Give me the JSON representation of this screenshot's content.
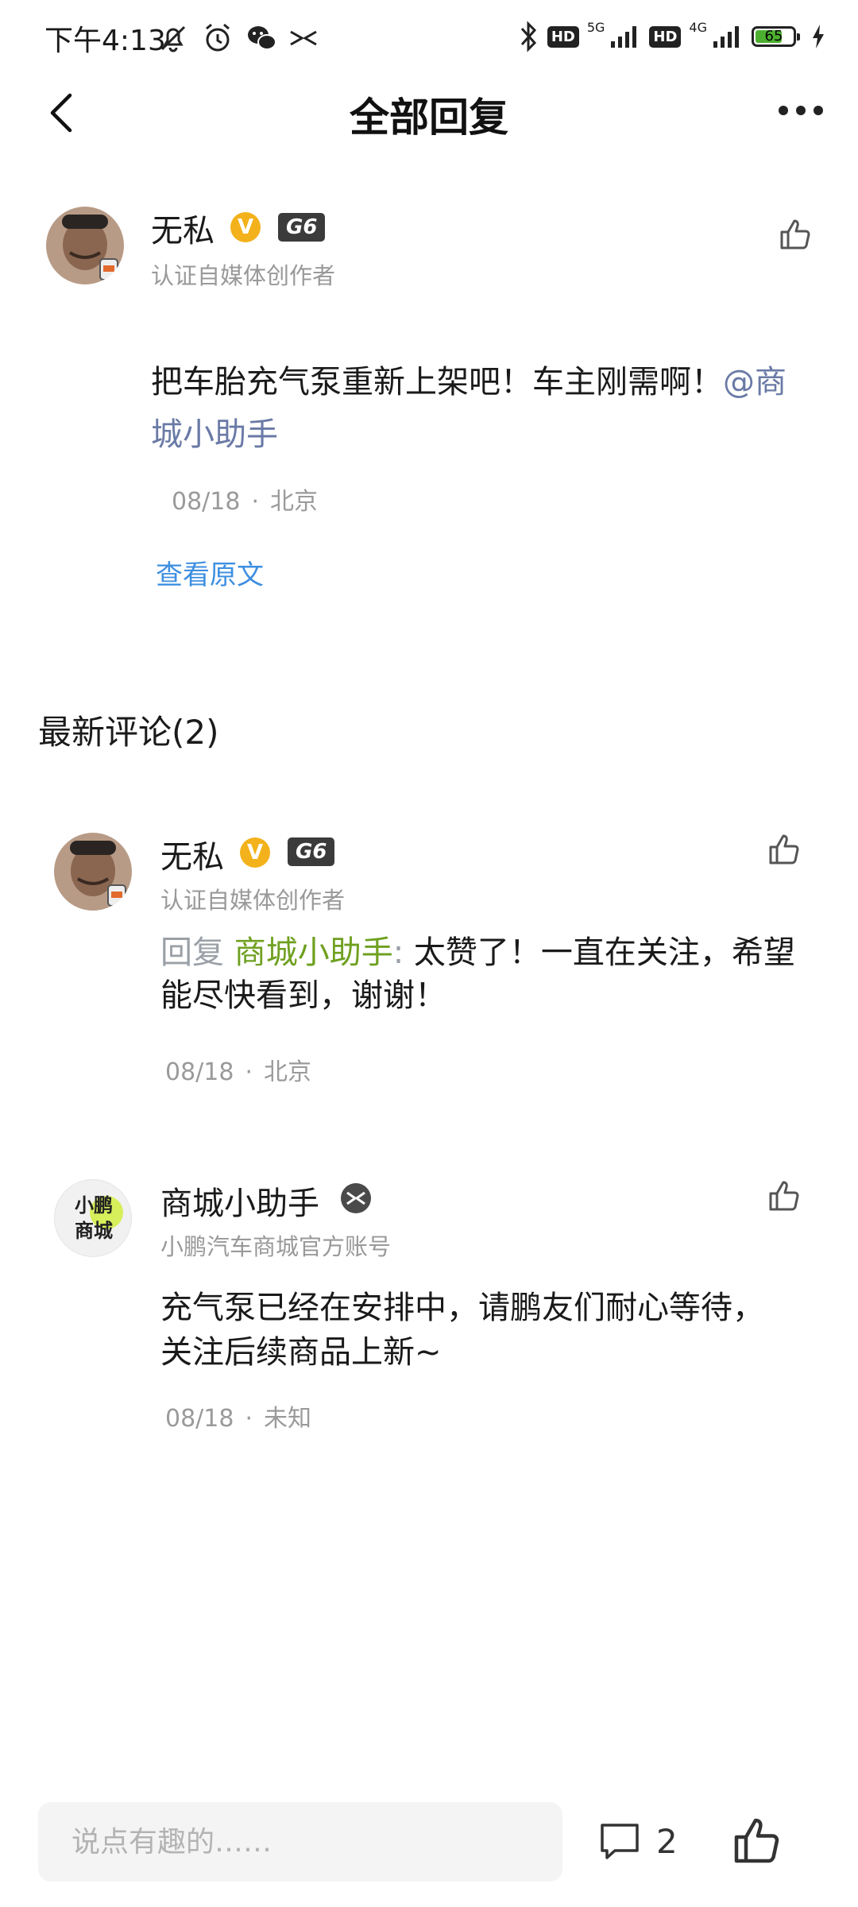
{
  "status_bar": {
    "time": "下午4:13",
    "icons": [
      "mute-icon",
      "alarm-icon",
      "wechat-icon",
      "xpeng-icon",
      "bluetooth-icon"
    ],
    "hd1": "HD",
    "net1": "5G",
    "hd2": "HD",
    "net2": "4G",
    "battery_level": 65
  },
  "header": {
    "title": "全部回复"
  },
  "post": {
    "author": "无私",
    "grade": "G6",
    "verified_mark": "V",
    "subtitle": "认证自媒体创作者",
    "text": "把车胎充气泵重新上架吧！车主刚需啊！",
    "mention": "@商城小助手",
    "date": "08/18",
    "location": "北京",
    "view_original": "查看原文"
  },
  "comments_section": {
    "title": "最新评论(2)"
  },
  "comments": [
    {
      "author": "无私",
      "grade": "G6",
      "verified_mark": "V",
      "subtitle": "认证自媒体创作者",
      "reply_label": "回复 ",
      "reply_target": "商城小助手",
      "reply_colon": ": ",
      "text": "太赞了！一直在关注，希望能尽快看到，谢谢！",
      "date": "08/18",
      "location": "北京"
    },
    {
      "author": "商城小助手",
      "avatar_text": "小鹏商城",
      "subtitle": "小鹏汽车商城官方账号",
      "text": "充气泵已经在安排中，请鹏友们耐心等待，关注后续商品上新~",
      "date": "08/18",
      "location": "未知"
    }
  ],
  "bottom_bar": {
    "input_placeholder": "说点有趣的……",
    "comment_count": "2"
  },
  "colors": {
    "mention": "#6a7aa6",
    "reply_name": "#6fa020",
    "link": "#3d8fe0",
    "verified": "#f3b21b"
  }
}
